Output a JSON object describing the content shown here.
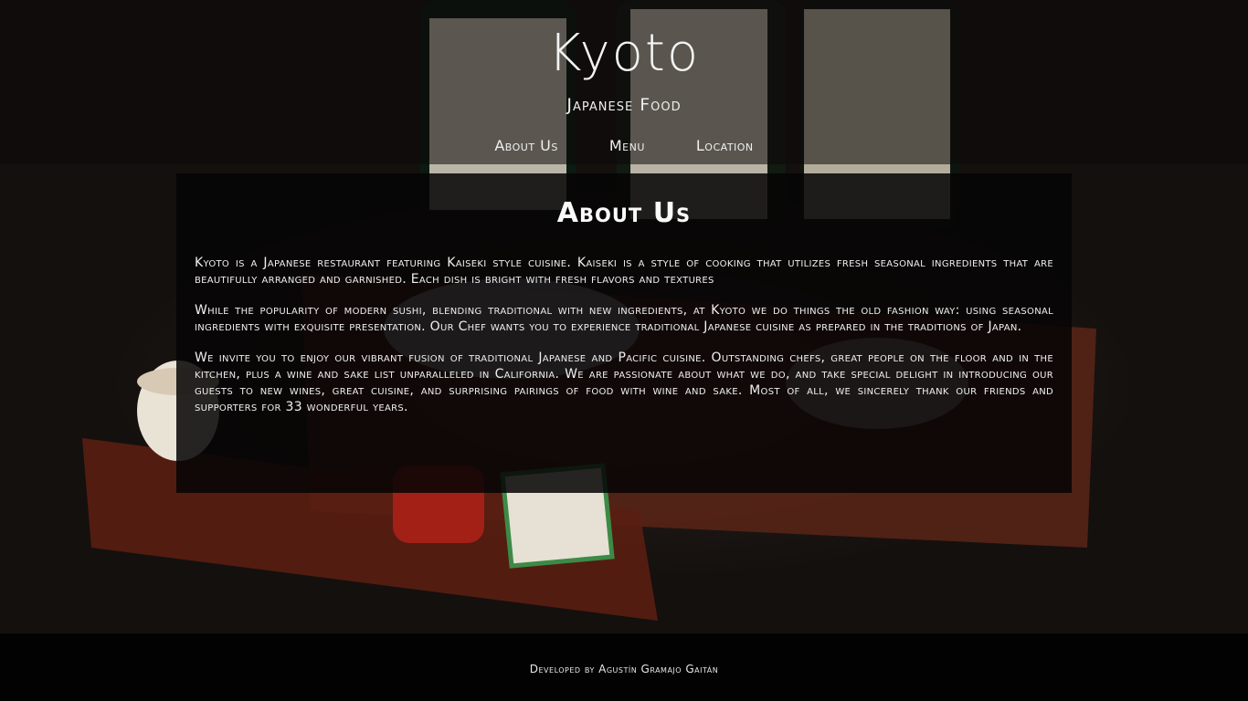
{
  "header": {
    "brand": "Kyoto",
    "tagline": "Japanese Food",
    "nav": [
      {
        "label": "About Us"
      },
      {
        "label": "Menu"
      },
      {
        "label": "Location"
      }
    ]
  },
  "main": {
    "title": "About Us",
    "paragraphs": [
      "Kyoto is a Japanese restaurant featuring Kaiseki style cuisine. Kaiseki is a style of cooking that utilizes fresh seasonal ingredients that are beautifully arranged and garnished. Each dish is bright with fresh flavors and textures",
      "While the popularity of modern sushi, blending traditional with new ingredients, at Kyoto we do things the old fashion way: using seasonal ingredients with exquisite presentation. Our Chef wants you to experience traditional Japanese cuisine as prepared in the traditions of Japan.",
      "We invite you to enjoy our vibrant fusion of traditional Japanese and Pacific cuisine. Outstanding chefs, great people on the floor and in the kitchen, plus a wine and sake list unparalleled in California. We are passionate about what we do, and take special delight in introducing our guests to new wines, great cuisine, and surprising pairings of food with wine and sake. Most of all, we sincerely thank our friends and supporters for 33 wonderful years."
    ]
  },
  "footer": {
    "credit": "Developed by Agustín Gramajo Gaitán"
  }
}
